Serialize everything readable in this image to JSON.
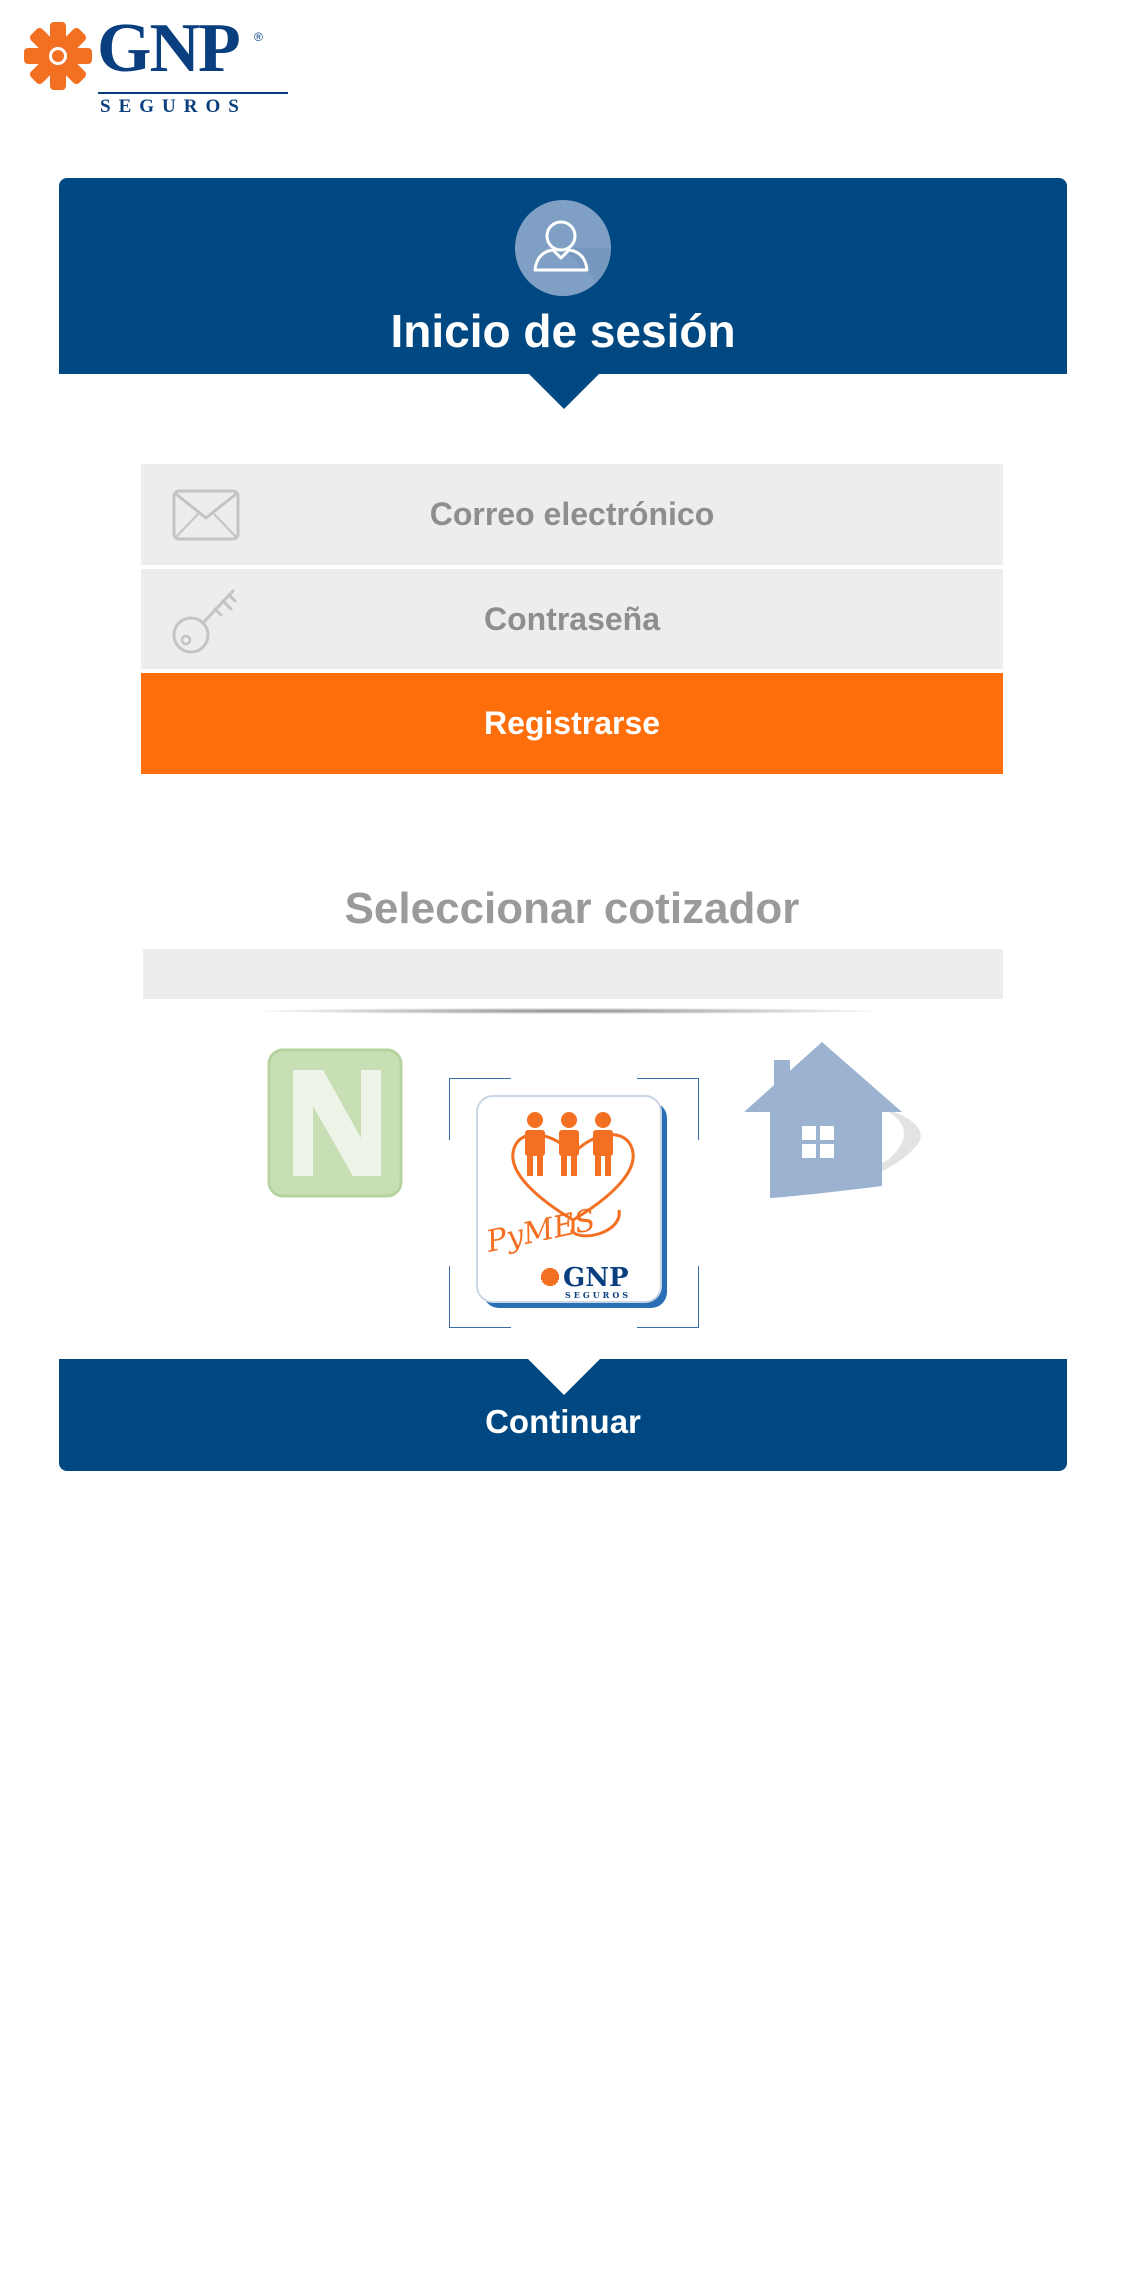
{
  "brand": {
    "name": "GNP",
    "tagline": "SEGUROS",
    "registered_mark": "®",
    "colors": {
      "primary": "#004882",
      "accent": "#fe6f0c",
      "field_bg": "#ededed",
      "muted_text": "#8e8e8e"
    }
  },
  "header": {
    "title": "Inicio de sesión",
    "icon": "user-icon"
  },
  "login_form": {
    "email": {
      "placeholder": "Correo electrónico",
      "value": "",
      "icon": "envelope-icon"
    },
    "password": {
      "placeholder": "Contraseña",
      "value": "",
      "icon": "key-icon"
    },
    "register_label": "Registrarse"
  },
  "cotizador": {
    "title": "Seleccionar cotizador",
    "selected_value": "",
    "options": [
      {
        "id": "n",
        "icon": "n-logo-icon",
        "selected": false
      },
      {
        "id": "pymes",
        "icon": "pymes-gnp-icon",
        "label": "PyMES",
        "brand": "GNP",
        "brand_tagline": "SEGUROS",
        "selected": true
      },
      {
        "id": "home",
        "icon": "house-icon",
        "selected": false
      }
    ]
  },
  "continue_label": "Continuar"
}
